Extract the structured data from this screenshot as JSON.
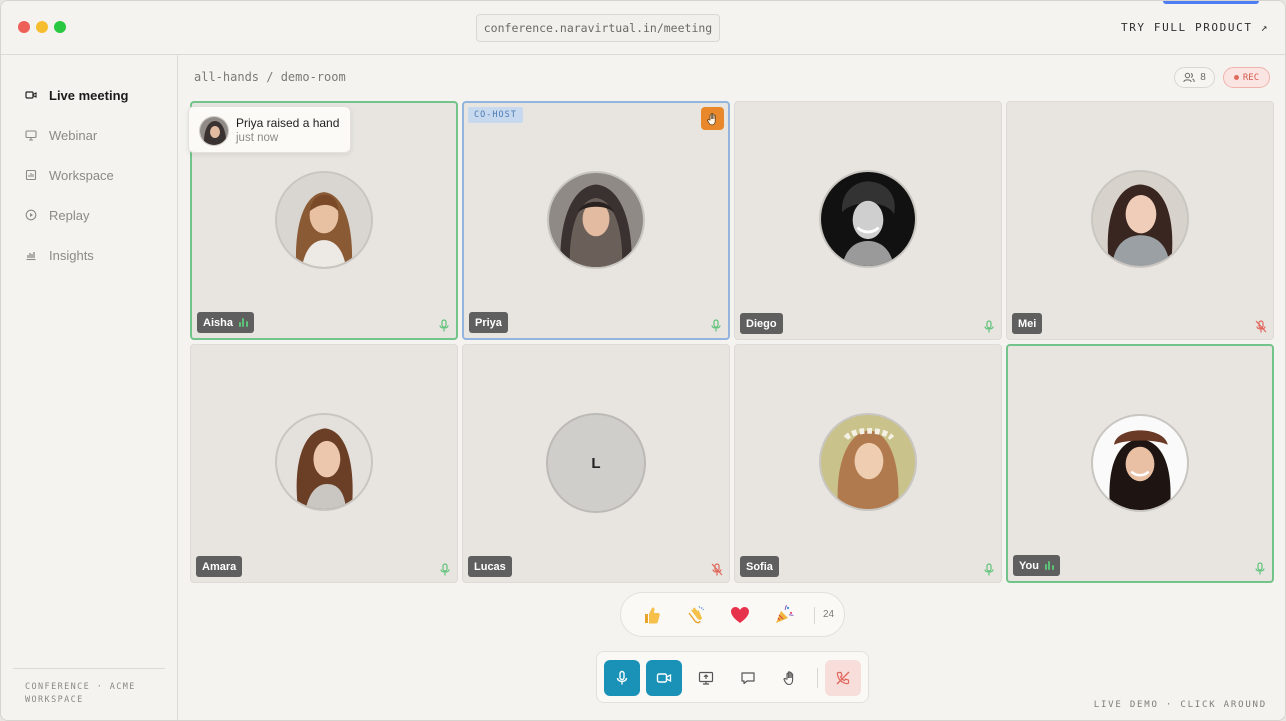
{
  "browser": {
    "url": "conference.naravirtual.in/meeting",
    "try_label": "TRY FULL PRODUCT ↗"
  },
  "sidebar": {
    "items": [
      {
        "label": "Live meeting",
        "icon": "video-icon",
        "active": true
      },
      {
        "label": "Webinar",
        "icon": "monitor-icon",
        "active": false
      },
      {
        "label": "Workspace",
        "icon": "grid-icon",
        "active": false
      },
      {
        "label": "Replay",
        "icon": "play-icon",
        "active": false
      },
      {
        "label": "Insights",
        "icon": "chart-icon",
        "active": false
      }
    ],
    "footer_line1": "CONFERENCE · ACME",
    "footer_line2": "WORKSPACE"
  },
  "header": {
    "breadcrumb": "all-hands / demo-room",
    "participant_count": "8",
    "rec_label": "REC"
  },
  "toast": {
    "title": "Priya raised a hand",
    "subtitle": "just now"
  },
  "participants": [
    {
      "name": "Aisha",
      "speaking": true,
      "muted": false
    },
    {
      "name": "Priya",
      "role": "CO-HOST",
      "hand_raised": true,
      "muted": false
    },
    {
      "name": "Diego",
      "muted": false
    },
    {
      "name": "Mei",
      "muted": true
    },
    {
      "name": "Amara",
      "muted": false
    },
    {
      "name": "Lucas",
      "initial": "L",
      "muted": true
    },
    {
      "name": "Sofia",
      "muted": false
    },
    {
      "name": "You",
      "speaking": true,
      "muted": false
    }
  ],
  "reactions": {
    "items": [
      "👍",
      "👏",
      "❤️",
      "🎉"
    ],
    "count": "24"
  },
  "colors": {
    "accent": "#1a92b8",
    "speaking_border": "#72c48a",
    "cohost_border": "#93b4dc",
    "hand": "#e9882a",
    "rec": "#d5594f",
    "muted": "#e0665c"
  },
  "footer": {
    "live_demo": "LIVE DEMO · CLICK AROUND"
  }
}
